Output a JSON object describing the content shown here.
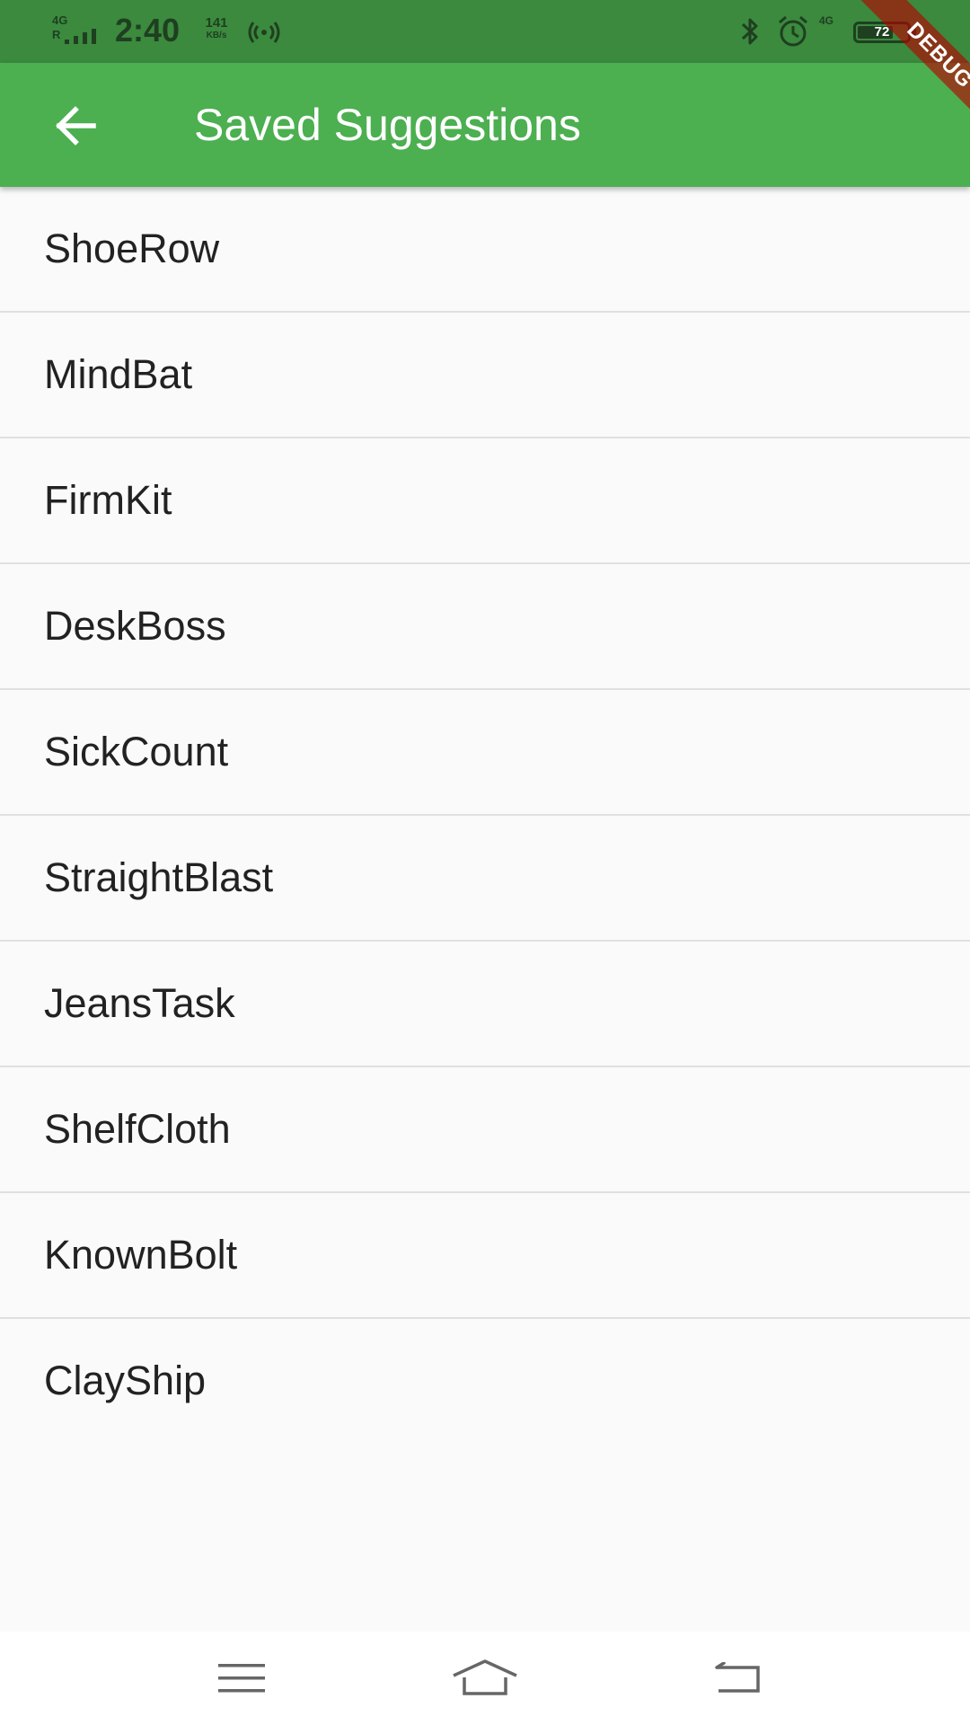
{
  "status_bar": {
    "network_type": "4G",
    "roaming": "R",
    "time": "2:40",
    "speed_value": "141",
    "speed_unit": "KB/s",
    "secondary_network": "4G",
    "battery_level": "72",
    "battery_fraction": 0.72,
    "icons": [
      "signal-icon",
      "hotspot-icon",
      "bluetooth-icon",
      "alarm-icon",
      "battery-icon"
    ]
  },
  "app_bar": {
    "title": "Saved Suggestions",
    "back_icon": "arrow-back-icon",
    "color": "#4caf50"
  },
  "debug_banner": {
    "label": "DEBUG"
  },
  "saved_list": {
    "items": [
      "ShoeRow",
      "MindBat",
      "FirmKit",
      "DeskBoss",
      "SickCount",
      "StraightBlast",
      "JeansTask",
      "ShelfCloth",
      "KnownBolt",
      "ClayShip"
    ]
  },
  "nav_bar": {
    "icons": [
      "menu-icon",
      "home-icon",
      "back-icon"
    ]
  },
  "colors": {
    "status_bar": "#3b8a3e",
    "app_bar": "#4caf50",
    "background": "#fafafa",
    "divider": "#e0e0e0",
    "text": "#222222"
  }
}
